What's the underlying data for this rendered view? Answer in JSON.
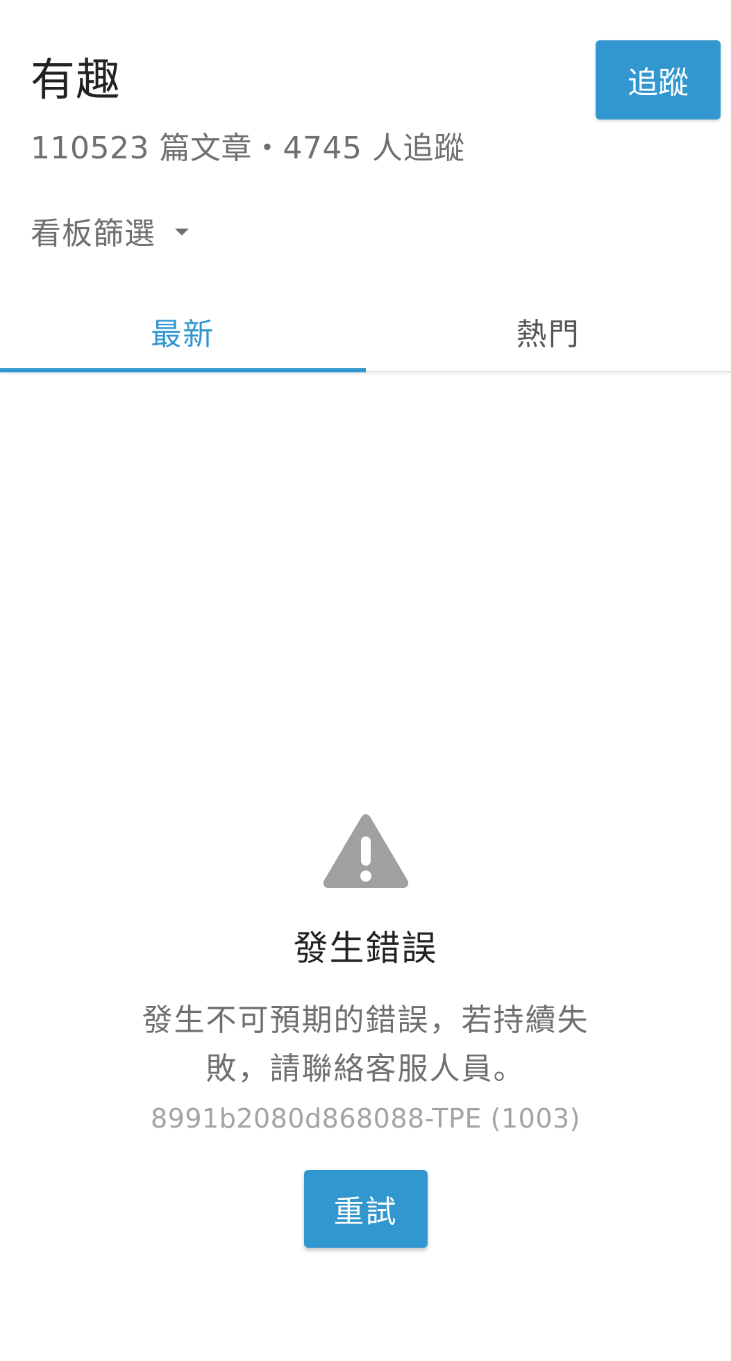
{
  "header": {
    "title": "有趣",
    "follow_label": "追蹤",
    "article_count": "110523",
    "article_unit": "篇文章",
    "separator": "・",
    "follower_count": "4745",
    "follower_unit": "人追蹤",
    "filter_label": "看板篩選"
  },
  "tabs": [
    {
      "label": "最新",
      "active": true
    },
    {
      "label": "熱門",
      "active": false
    }
  ],
  "error": {
    "icon": "warning-icon",
    "title": "發生錯誤",
    "message": "發生不可預期的錯誤，若持續失敗，請聯絡客服人員。",
    "code": "8991b2080d868088-TPE (1003)",
    "retry_label": "重試"
  },
  "colors": {
    "accent": "#3397cf",
    "icon_gray": "#a0a0a0",
    "text_primary": "#222222",
    "text_secondary": "#6f6f6f"
  }
}
